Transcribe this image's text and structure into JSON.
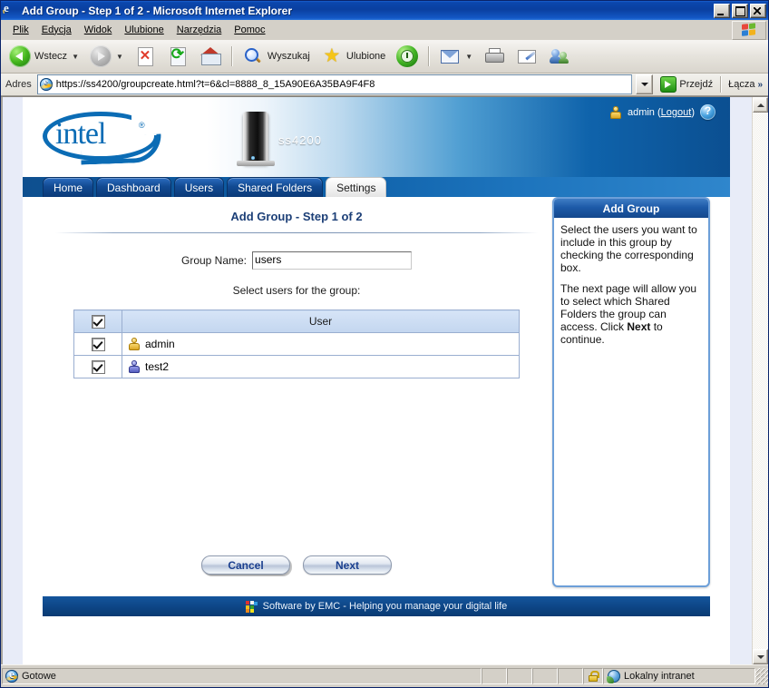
{
  "window": {
    "title": "Add Group - Step 1 of 2 - Microsoft Internet Explorer",
    "icon": "ie-document-icon",
    "minimize_label": "Minimize",
    "maximize_label": "Maximize",
    "close_label": "Close"
  },
  "menubar": {
    "items": [
      {
        "label": "Plik",
        "accel": "P"
      },
      {
        "label": "Edycja",
        "accel": "E"
      },
      {
        "label": "Widok",
        "accel": "W"
      },
      {
        "label": "Ulubione",
        "accel": "U"
      },
      {
        "label": "Narzędzia",
        "accel": "N"
      },
      {
        "label": "Pomoc",
        "accel": "c"
      }
    ]
  },
  "toolbar": {
    "back_label": "Wstecz",
    "forward_label": "",
    "search_label": "Wyszukaj",
    "favorites_label": "Ulubione",
    "stop_label": "",
    "refresh_label": "",
    "home_label": "",
    "history_label": "",
    "mail_label": "",
    "print_label": "",
    "edit_label": "",
    "messenger_label": ""
  },
  "addressbar": {
    "label": "Adres",
    "url": "https://ss4200/groupcreate.html?t=6&cl=8888_8_15A90E6A35BA9F4F8",
    "go_label": "Przejdź",
    "links_label": "Łącza",
    "links_chevron": "»"
  },
  "app": {
    "brand": "intel",
    "brand_trademark": "®",
    "device_name": "ss4200",
    "user_name": "admin",
    "logout_label": "Logout",
    "logout_open": "(",
    "logout_close": ")",
    "help_icon_label": "?"
  },
  "tabs": [
    {
      "label": "Home",
      "active": false
    },
    {
      "label": "Dashboard",
      "active": false
    },
    {
      "label": "Users",
      "active": false
    },
    {
      "label": "Shared Folders",
      "active": false
    },
    {
      "label": "Settings",
      "active": true
    }
  ],
  "main": {
    "page_title": "Add Group - Step 1 of 2",
    "group_name_label": "Group Name:",
    "group_name_value": "users",
    "select_users_label": "Select users for the group:",
    "table": {
      "header_check_checked": true,
      "header_user": "User",
      "rows": [
        {
          "checked": true,
          "icon": "user-icon-gold",
          "name": "admin"
        },
        {
          "checked": true,
          "icon": "user-icon-blue",
          "name": "test2"
        }
      ]
    },
    "cancel_label": "Cancel",
    "next_label": "Next"
  },
  "help": {
    "title": "Add Group",
    "paragraph1": "Select the users you want to include in this group by checking the corresponding box.",
    "paragraph2_part1": "The next page will allow you to select which Shared Folders the group can access. Click ",
    "paragraph2_bold": "Next",
    "paragraph2_part2": " to continue."
  },
  "footer": {
    "text": "Software by EMC - Helping you manage your digital life"
  },
  "statusbar": {
    "status": "Gotowe",
    "zone": "Lokalny intranet"
  },
  "colors": {
    "title_blue": "#0a3fa0",
    "intel_blue": "#0b6cb5",
    "header_blue": "#0b4f91",
    "tab_active_bg": "#f1f1f1",
    "panel_border": "#6d9fd8",
    "button_text": "#1a3f8f",
    "chrome_gray": "#d4d0c8"
  }
}
